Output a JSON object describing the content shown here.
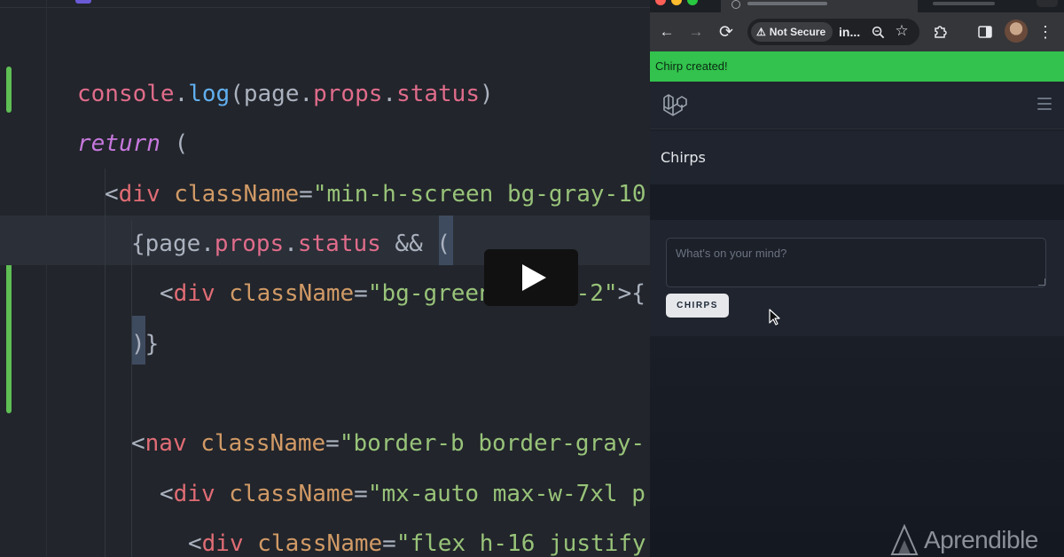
{
  "editor": {
    "lines": [
      {
        "parts": [
          [
            "console",
            "kw-log"
          ],
          [
            ".",
            "punct"
          ],
          [
            "log",
            "kw-fn"
          ],
          [
            "(page.",
            "punct"
          ],
          [
            "props",
            "kw-prop"
          ],
          [
            ".",
            "punct"
          ],
          [
            "status",
            "kw-prop"
          ],
          [
            ")",
            "punct"
          ]
        ]
      },
      {
        "parts": [
          [
            "return",
            "kw-ret"
          ],
          [
            " (",
            "punct"
          ]
        ]
      },
      {
        "parts": [
          [
            "<",
            "punct"
          ],
          [
            "div",
            "tag"
          ],
          [
            " ",
            "punct"
          ],
          [
            "className",
            "attr"
          ],
          [
            "=",
            "punct"
          ],
          [
            "\"min-h-screen bg-gray-10",
            "str"
          ]
        ]
      },
      {
        "parts": [
          [
            "{page.",
            "punct"
          ],
          [
            "props",
            "kw-prop"
          ],
          [
            ".",
            "punct"
          ],
          [
            "status",
            "kw-prop"
          ],
          [
            " && ",
            "punct"
          ],
          [
            "(",
            "punct"
          ]
        ]
      },
      {
        "parts": [
          [
            "<",
            "punct"
          ],
          [
            "div",
            "tag"
          ],
          [
            " ",
            "punct"
          ],
          [
            "className",
            "attr"
          ],
          [
            "=",
            "punct"
          ],
          [
            "\"bg-green-500 p-2\"",
            "str"
          ],
          [
            ">{",
            "punct"
          ]
        ]
      },
      {
        "parts": [
          [
            ")}",
            "punct"
          ]
        ]
      },
      {
        "parts": [
          [
            "<",
            "punct"
          ],
          [
            "nav",
            "tag"
          ],
          [
            " ",
            "punct"
          ],
          [
            "className",
            "attr"
          ],
          [
            "=",
            "punct"
          ],
          [
            "\"border-b border-gray-",
            "str"
          ]
        ]
      },
      {
        "parts": [
          [
            "<",
            "punct"
          ],
          [
            "div",
            "tag"
          ],
          [
            " ",
            "punct"
          ],
          [
            "className",
            "attr"
          ],
          [
            "=",
            "punct"
          ],
          [
            "\"mx-auto max-w-7xl p",
            "str"
          ]
        ]
      },
      {
        "parts": [
          [
            "<",
            "punct"
          ],
          [
            "div",
            "tag"
          ],
          [
            " ",
            "punct"
          ],
          [
            "className",
            "attr"
          ],
          [
            "=",
            "punct"
          ],
          [
            "\"flex h-16 justify",
            "str"
          ]
        ]
      }
    ]
  },
  "colors": {
    "flash_bg": "#32c24d",
    "git_added": "#5fbf55",
    "editor_bg": "#22252b"
  },
  "player": {
    "icon": "play-icon"
  },
  "browser": {
    "security_label": "Not Secure",
    "url": "in...",
    "icons": {
      "back": "←",
      "forward": "→",
      "reload": "⟳",
      "zoom": "zoom-icon",
      "star": "☆",
      "extensions": "puzzle-icon",
      "sidepanel": "sidepanel-icon",
      "menu": "⋮"
    }
  },
  "app": {
    "flash_message": "Chirp created!",
    "page_title": "Chirps",
    "textarea_placeholder": "What's on your mind?",
    "submit_label": "CHIRPS"
  },
  "watermark": {
    "text": "Aprendible"
  }
}
